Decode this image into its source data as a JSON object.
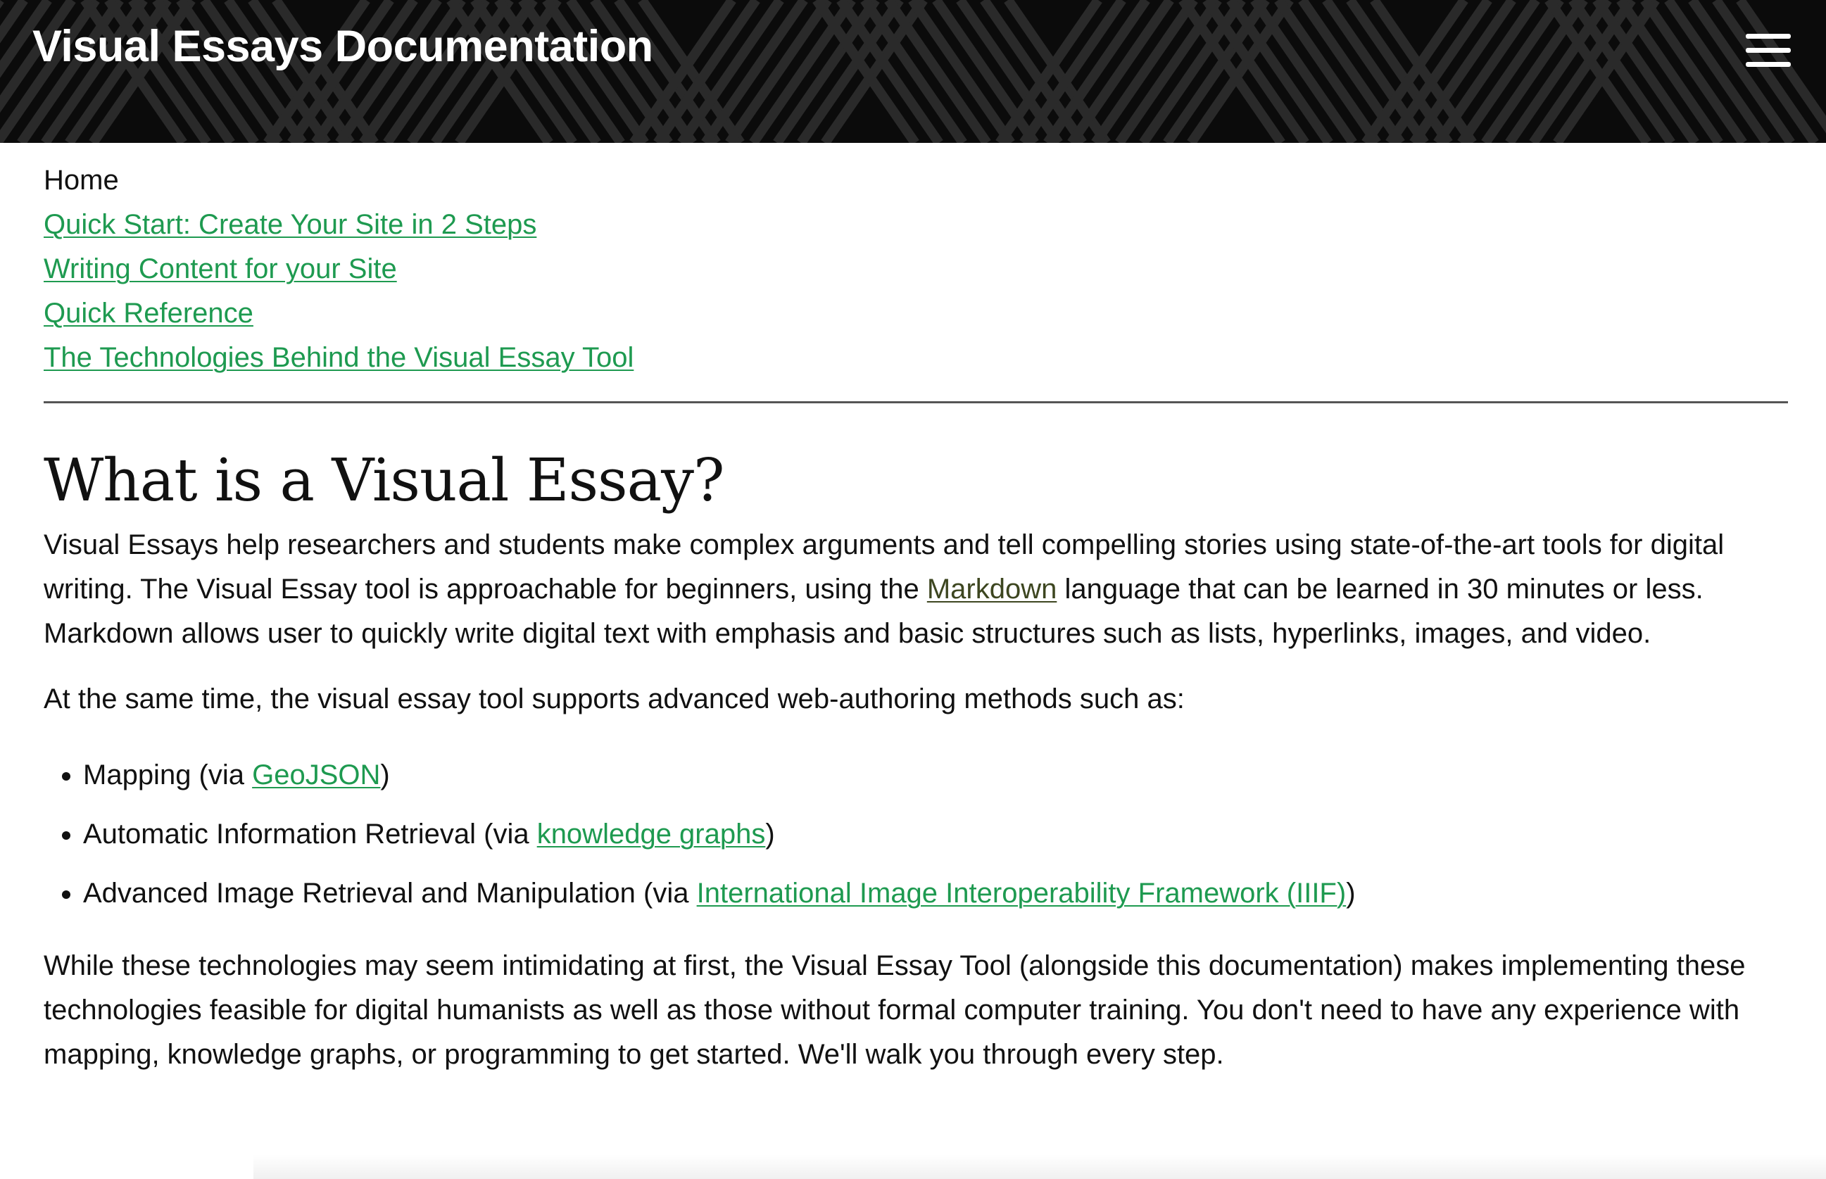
{
  "header": {
    "title": "Visual Essays Documentation",
    "menu_icon": "hamburger-menu-icon"
  },
  "nav": {
    "home": "Home",
    "links": [
      "Quick Start: Create Your Site in 2 Steps",
      "Writing Content for your Site",
      "Quick Reference",
      "The Technologies Behind the Visual Essay Tool"
    ]
  },
  "main": {
    "heading": "What is a Visual Essay?",
    "intro": {
      "before_link": "Visual Essays help researchers and students make complex arguments and tell compelling stories using state-of-the-art tools for digital writing. The Visual Essay tool is approachable for beginners, using the ",
      "link": "Markdown",
      "after_link": " language that can be learned in 30 minutes or less. Markdown allows user to quickly write digital text with emphasis and basic structures such as lists, hyperlinks, images, and video."
    },
    "advanced_intro": "At the same time, the visual essay tool supports advanced web-authoring methods such as:",
    "methods": [
      {
        "before": "Mapping (via ",
        "link": "GeoJSON",
        "after": ")"
      },
      {
        "before": "Automatic Information Retrieval (via ",
        "link": "knowledge graphs",
        "after": ")"
      },
      {
        "before": "Advanced Image Retrieval and Manipulation (via ",
        "link": "International Image Interoperability Framework (IIIF)",
        "after": ")"
      }
    ],
    "closing": "While these technologies may seem intimidating at first, the Visual Essay Tool (alongside this documentation) makes implementing these technologies feasible for digital humanists as well as those without formal computer training. You don't need to have any experience with mapping, knowledge graphs, or programming to get started. We'll walk you through every step."
  },
  "colors": {
    "link": "#1e9a50",
    "link_visited": "#3d4620",
    "header_bg": "#0b0b0b"
  }
}
